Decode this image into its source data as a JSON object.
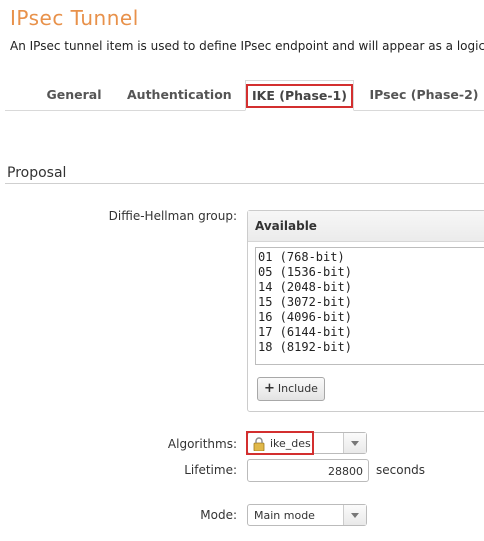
{
  "header": {
    "title": "IPsec Tunnel",
    "description": "An IPsec tunnel item is used to define IPsec endpoint and will appear as a logical"
  },
  "tabs": [
    {
      "label": "General"
    },
    {
      "label": "Authentication"
    },
    {
      "label": "IKE (Phase-1)",
      "active": true
    },
    {
      "label": "IPsec (Phase-2)"
    }
  ],
  "section": {
    "title": "Proposal"
  },
  "dh_group": {
    "label": "Diffie-Hellman group:",
    "panel_header": "Available",
    "options": [
      "01 (768-bit)",
      "05 (1536-bit)",
      "14 (2048-bit)",
      "15 (3072-bit)",
      "16 (4096-bit)",
      "17 (6144-bit)",
      "18 (8192-bit)"
    ],
    "include_label": "Include",
    "include_icon": "plus-icon"
  },
  "algorithms": {
    "label": "Algorithms:",
    "value": "ike_des",
    "icon": "lock-icon"
  },
  "lifetime": {
    "label": "Lifetime:",
    "value": "28800",
    "unit": "seconds"
  },
  "mode": {
    "label": "Mode:",
    "value": "Main mode"
  },
  "colors": {
    "title": "#e8914a",
    "highlight": "#d32f2f"
  }
}
